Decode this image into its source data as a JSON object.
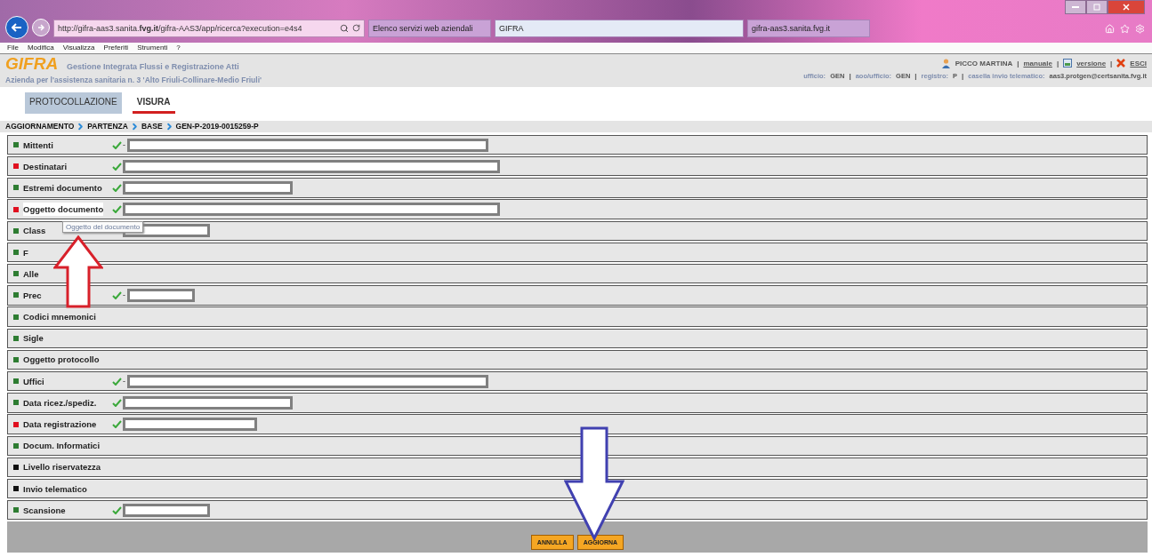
{
  "browser": {
    "address": "http://gifra-aas3.sanita.**fvg.it**/gifra-AAS3/app/ricerca?execution=e4s4",
    "tabs": [
      {
        "label": "Elenco servizi web aziendali",
        "selected": false
      },
      {
        "label": "GIFRA",
        "selected": true
      },
      {
        "label": "gifra-aas3.sanita.fvg.it",
        "selected": false
      }
    ],
    "menu": [
      "File",
      "Modifica",
      "Visualizza",
      "Preferiti",
      "Strumenti",
      "?"
    ]
  },
  "header": {
    "logo": "GIFRA",
    "title": "Gestione Integrata Flussi e Registrazione Atti",
    "organization": "Azienda per l'assistenza sanitaria n. 3 'Alto Friuli-Collinare-Medio Friuli'",
    "user": "PICCO MARTINA",
    "separator": "|",
    "links": [
      {
        "kind": "manual",
        "label": "manuale"
      },
      {
        "kind": "version",
        "label": "versione"
      },
      {
        "kind": "exit",
        "label": "ESCI"
      }
    ],
    "info": [
      {
        "label": "ufficio:",
        "value": "GEN"
      },
      {
        "label": "aoo/ufficio:",
        "value": "GEN"
      },
      {
        "label": "registro:",
        "value": "P"
      },
      {
        "label": "casella invio telematico:",
        "value": "aas3.protgen@certsanita.fvg.it"
      }
    ]
  },
  "nav_tabs": [
    {
      "label": "PROTOCOLLAZIONE",
      "selected": false
    },
    {
      "label": "VISURA",
      "selected": true
    }
  ],
  "breadcrumb": [
    "AGGIORNAMENTO",
    "PARTENZA",
    "BASE",
    "GEN-P-2019-0015259-P"
  ],
  "sections": [
    {
      "label": "Mittenti",
      "color": "#2e7d32",
      "checked": true,
      "prefix": "-",
      "kind": "long"
    },
    {
      "label": "Destinatari",
      "color": "#e01020",
      "checked": true,
      "kind": "longer"
    },
    {
      "label": "Estremi documento",
      "color": "#2e7d32",
      "checked": true,
      "kind": "medium"
    },
    {
      "label": "Oggetto documento",
      "color": "#e01020",
      "checked": true,
      "kind": "longer",
      "highlighted": true
    },
    {
      "label": "Class",
      "color": "#2e7d32",
      "checked": false,
      "kind": "small"
    },
    {
      "label": "F",
      "color": "#2e7d32",
      "checked": false,
      "kind": "plain"
    },
    {
      "label": "Alle",
      "color": "#2e7d32",
      "checked": false,
      "kind": "plain"
    },
    {
      "label": "Prec",
      "color": "#2e7d32",
      "checked": true,
      "prefix": "-",
      "kind": "tiny"
    },
    {
      "label": "Codici mnemonici",
      "color": "#2e7d32",
      "checked": false,
      "kind": "plain"
    },
    {
      "label": "Sigle",
      "color": "#2e7d32",
      "checked": false,
      "kind": "plain"
    },
    {
      "label": "Oggetto protocollo",
      "color": "#2e7d32",
      "checked": false,
      "kind": "plain"
    },
    {
      "label": "Uffici",
      "color": "#2e7d32",
      "checked": true,
      "prefix": "-",
      "kind": "long"
    },
    {
      "label": "Data ricez./spediz.",
      "color": "#2e7d32",
      "checked": true,
      "kind": "medium"
    },
    {
      "label": "Data registrazione",
      "color": "#e01020",
      "checked": true,
      "kind": "short"
    },
    {
      "label": "Docum. Informatici",
      "color": "#2e7d32",
      "checked": false,
      "kind": "plain"
    },
    {
      "label": "Livello riservatezza",
      "color": "#111111",
      "checked": false,
      "kind": "plain"
    },
    {
      "label": "Invio telematico",
      "color": "#111111",
      "checked": false,
      "kind": "plain"
    },
    {
      "label": "Scansione",
      "color": "#2e7d32",
      "checked": true,
      "kind": "small"
    }
  ],
  "tooltip": "Oggetto del documento",
  "buttons": [
    "ANNULLA",
    "AGGIORNA"
  ]
}
